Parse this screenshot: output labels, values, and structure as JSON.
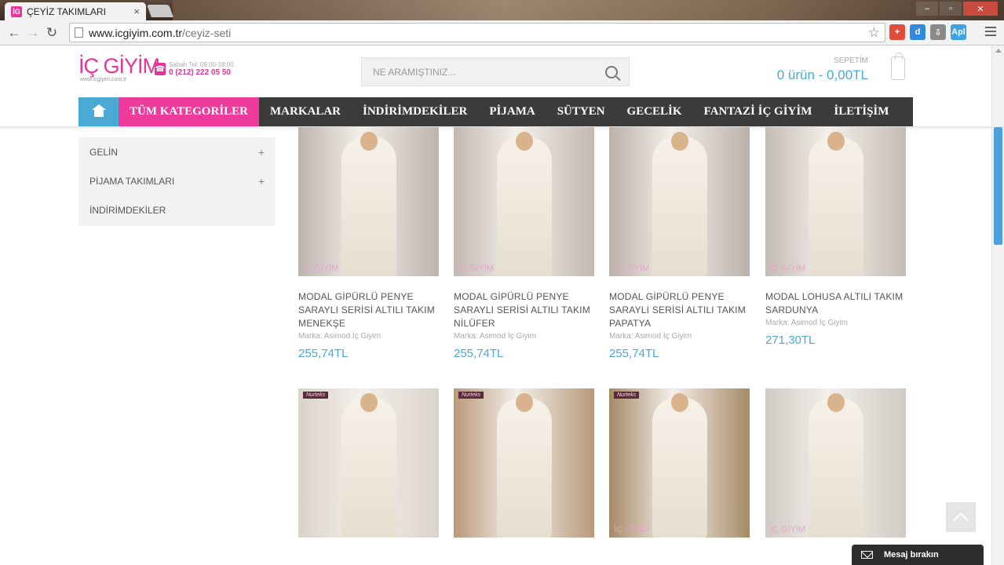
{
  "browser": {
    "tab_title": "ÇEYİZ TAKIMLARI",
    "tab_close": "×",
    "favicon_text": "İG",
    "url_host": "www.icgiyim.com.tr",
    "url_path": "/ceyiz-seti",
    "controls": {
      "minimize": "–",
      "maximize": "▫",
      "close": "✕"
    },
    "extensions": [
      {
        "name": "plus-extension-icon",
        "glyph": "+",
        "color": "#e34b3b"
      },
      {
        "name": "d-extension-icon",
        "glyph": "d",
        "color": "#2f8be0"
      },
      {
        "name": "download-extension-icon",
        "glyph": "⇩",
        "color": "#8a8a8a"
      },
      {
        "name": "apps-extension-icon",
        "glyph": "Apl",
        "color": "#3fa3e3"
      }
    ]
  },
  "header": {
    "logo_text": "İÇ GİYİM",
    "logo_sub": "www.icgiyim.com.tr",
    "phone_hours": "Sabah Tel: 09:00-18:00",
    "phone_number": "0 (212) 222 05 50",
    "search_placeholder": "NE ARAMIŞTINIZ...",
    "cart_label": "SEPETİM",
    "cart_total": "0 ürün - 0,00TL"
  },
  "nav": {
    "categories": "TÜM KATEGORİLER",
    "items": [
      "MARKALAR",
      "İNDİRİMDEKİLER",
      "PİJAMA",
      "SÜTYEN",
      "GECELİK",
      "FANTAZİ İÇ GİYİM",
      "İLETİŞİM"
    ]
  },
  "sidebar": {
    "items": [
      {
        "label": "GELİN",
        "expand": "+"
      },
      {
        "label": "PİJAMA TAKIMLARI",
        "expand": "+"
      },
      {
        "label": "İNDİRİMDEKİLER",
        "expand": ""
      }
    ]
  },
  "products": [
    {
      "name": "MODAL GİPÜRLÜ PENYE SARAYLI SERİSİ ALTILI TAKIM MENEKŞE",
      "brand": "Marka: Asimod İç Giyim",
      "price": "255,74TL",
      "badge": "İÇ GİYİM",
      "bg": "#bdb4ad"
    },
    {
      "name": "MODAL GİPÜRLÜ PENYE SARAYLI SERİSİ ALTILI TAKIM NİLÜFER",
      "brand": "Marka: Asimod İç Giyim",
      "price": "255,74TL",
      "badge": "İÇ GİYİM",
      "bg": "#c2b9b1"
    },
    {
      "name": "MODAL GİPÜRLÜ PENYE SARAYLI SERİSİ ALTILI TAKIM PAPATYA",
      "brand": "Marka: Asimod İç Giyim",
      "price": "255,74TL",
      "badge": "İÇ GİYİM",
      "bg": "#bab1aa"
    },
    {
      "name": "MODAL LOHUSA ALTILI TAKIM SARDUNYA",
      "brand": "Marka: Asimod İç Giyim",
      "price": "271,30TL",
      "badge": "İÇ GİYİM",
      "bg": "#c4bcb5"
    },
    {
      "name": "",
      "brand": "",
      "price": "",
      "badge": "",
      "tag": "Nurteks",
      "bg": "#d9d3ca"
    },
    {
      "name": "",
      "brand": "",
      "price": "",
      "badge": "",
      "tag": "Nurteks",
      "bg": "#b9987a"
    },
    {
      "name": "",
      "brand": "",
      "price": "",
      "badge": "İÇ GİYİM",
      "tag": "Nurteks",
      "bg": "#a78a66"
    },
    {
      "name": "",
      "brand": "",
      "price": "",
      "badge": "İÇ GİYİM",
      "tag": "",
      "bg": "#cfcac3"
    }
  ],
  "widgets": {
    "message_label": "Mesaj bırakın"
  }
}
